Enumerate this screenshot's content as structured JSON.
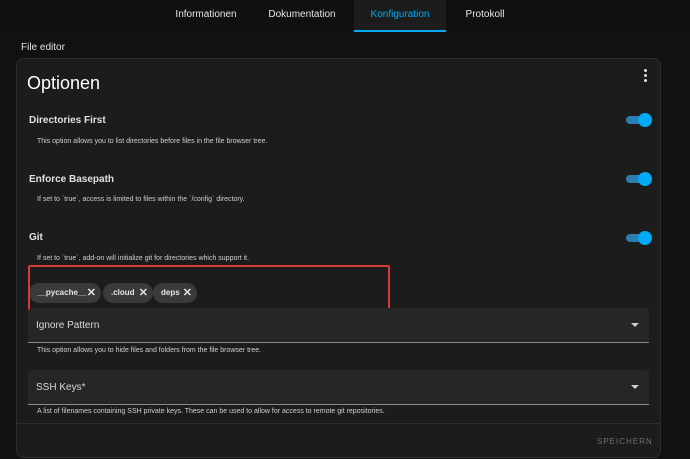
{
  "tabs": [
    {
      "label": "Informationen"
    },
    {
      "label": "Dokumentation"
    },
    {
      "label": "Konfiguration"
    },
    {
      "label": "Protokoll"
    }
  ],
  "active_tab": "Konfiguration",
  "section_title": "File editor",
  "card": {
    "title": "Optionen",
    "options": [
      {
        "label": "Directories First",
        "description": "This option allows you to list directories before files in the file browser tree.",
        "enabled": true
      },
      {
        "label": "Enforce Basepath",
        "description": "If set to `true`, access is limited to files within the `/config` directory.",
        "enabled": true
      },
      {
        "label": "Git",
        "description": "If set to `true`, add-on will initialize git for directories which support it.",
        "enabled": true
      }
    ],
    "chips": [
      {
        "label": "__pycache__"
      },
      {
        "label": ".cloud"
      },
      {
        "label": "deps"
      }
    ],
    "ignore_pattern": {
      "label": "Ignore Pattern",
      "helper": "This option allows you to hide files and folders from the file browser tree."
    },
    "ssh_keys": {
      "label": "SSH Keys*",
      "helper": "A list of filenames containing SSH private keys. These can be used to allow for access to remote git repositories."
    },
    "save_label": "SPEICHERN"
  },
  "colors": {
    "accent": "#03a9f4",
    "highlight": "#d63a3a",
    "background": "#111111",
    "card": "#1c1c1c"
  },
  "icons": {
    "menu": "more-vert-icon",
    "chip_remove": "close-icon",
    "dropdown": "caret-down-icon"
  }
}
